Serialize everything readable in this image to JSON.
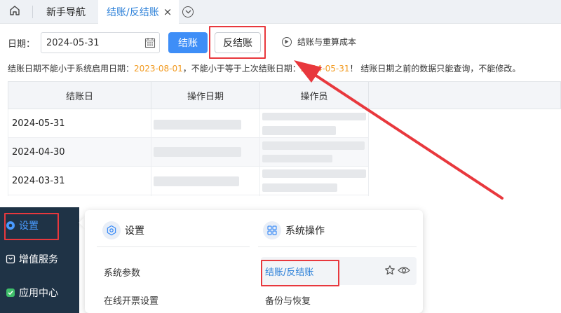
{
  "tabs": {
    "home_icon": "home-icon",
    "items": [
      {
        "label": "新手导航",
        "active": false
      },
      {
        "label": "结账/反结账",
        "active": true,
        "close": "×"
      }
    ],
    "more_icon": "chevron-down-circle-icon"
  },
  "toolbar": {
    "date_label": "日期：",
    "date_value": "2024-05-31",
    "calendar_icon": "calendar-icon",
    "close_button": "结账",
    "reverse_button": "反结账",
    "recalc_link": "结账与重算成本",
    "play_icon": "play-circle-icon"
  },
  "notice": {
    "part1": "结账日期不能小于系统启用日期：",
    "enable_date": "2023-08-01",
    "part2": "，不能小于等于上次结账日期：",
    "last_date": "2024-05-31",
    "part3": "！ 结账日期之前的数据只能查询，不能修改。"
  },
  "table": {
    "columns": [
      "结账日",
      "操作日期",
      "操作员"
    ],
    "rows": [
      {
        "close_date": "2024-05-31"
      },
      {
        "close_date": "2024-04-30"
      },
      {
        "close_date": "2024-03-31"
      }
    ]
  },
  "leftnav": {
    "items": [
      {
        "label": "设置",
        "icon": "gear-icon",
        "active": true
      },
      {
        "label": "增值服务",
        "icon": "gift-icon",
        "active": false
      },
      {
        "label": "应用中心",
        "icon": "shield-check-icon",
        "active": false
      }
    ]
  },
  "popup": {
    "col1": {
      "title": "设置",
      "icon": "gear-icon",
      "items": [
        "系统参数",
        "在线开票设置"
      ]
    },
    "col2": {
      "title": "系统操作",
      "icon": "grid-icon",
      "items": [
        "结账/反结账",
        "备份与恢复"
      ]
    },
    "star_icon": "star-icon",
    "eye_icon": "eye-icon"
  },
  "colors": {
    "accent": "#3e8ef7",
    "highlight": "#e8383d",
    "warning_text": "#f29a1f",
    "nav_bg": "#1f3346"
  }
}
